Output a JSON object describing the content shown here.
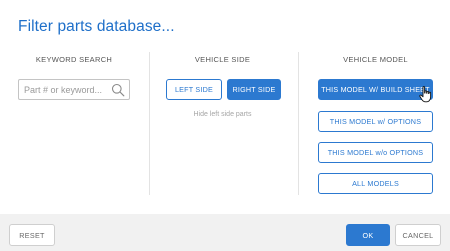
{
  "dialog": {
    "title": "Filter parts database..."
  },
  "keyword_search": {
    "heading": "KEYWORD SEARCH",
    "placeholder": "Part # or keyword...",
    "value": "",
    "icon": "search-icon"
  },
  "vehicle_side": {
    "heading": "VEHICLE SIDE",
    "left_label": "LEFT SIDE",
    "right_label": "RIGHT SIDE",
    "selected": "RIGHT SIDE",
    "hint": "Hide left side parts"
  },
  "vehicle_model": {
    "heading": "VEHICLE MODEL",
    "options": [
      {
        "label": "THIS MODEL W/ BUILD SHEET",
        "selected": true
      },
      {
        "label": "THIS MODEL w/ OPTIONS",
        "selected": false
      },
      {
        "label": "THIS MODEL w/o OPTIONS",
        "selected": false
      },
      {
        "label": "ALL MODELS",
        "selected": false
      }
    ]
  },
  "footer": {
    "reset_label": "RESET",
    "ok_label": "OK",
    "cancel_label": "CANCEL"
  },
  "colors": {
    "accent": "#2c79d0",
    "title": "#1e6fc9",
    "footer_bg": "#f1f1f1"
  }
}
